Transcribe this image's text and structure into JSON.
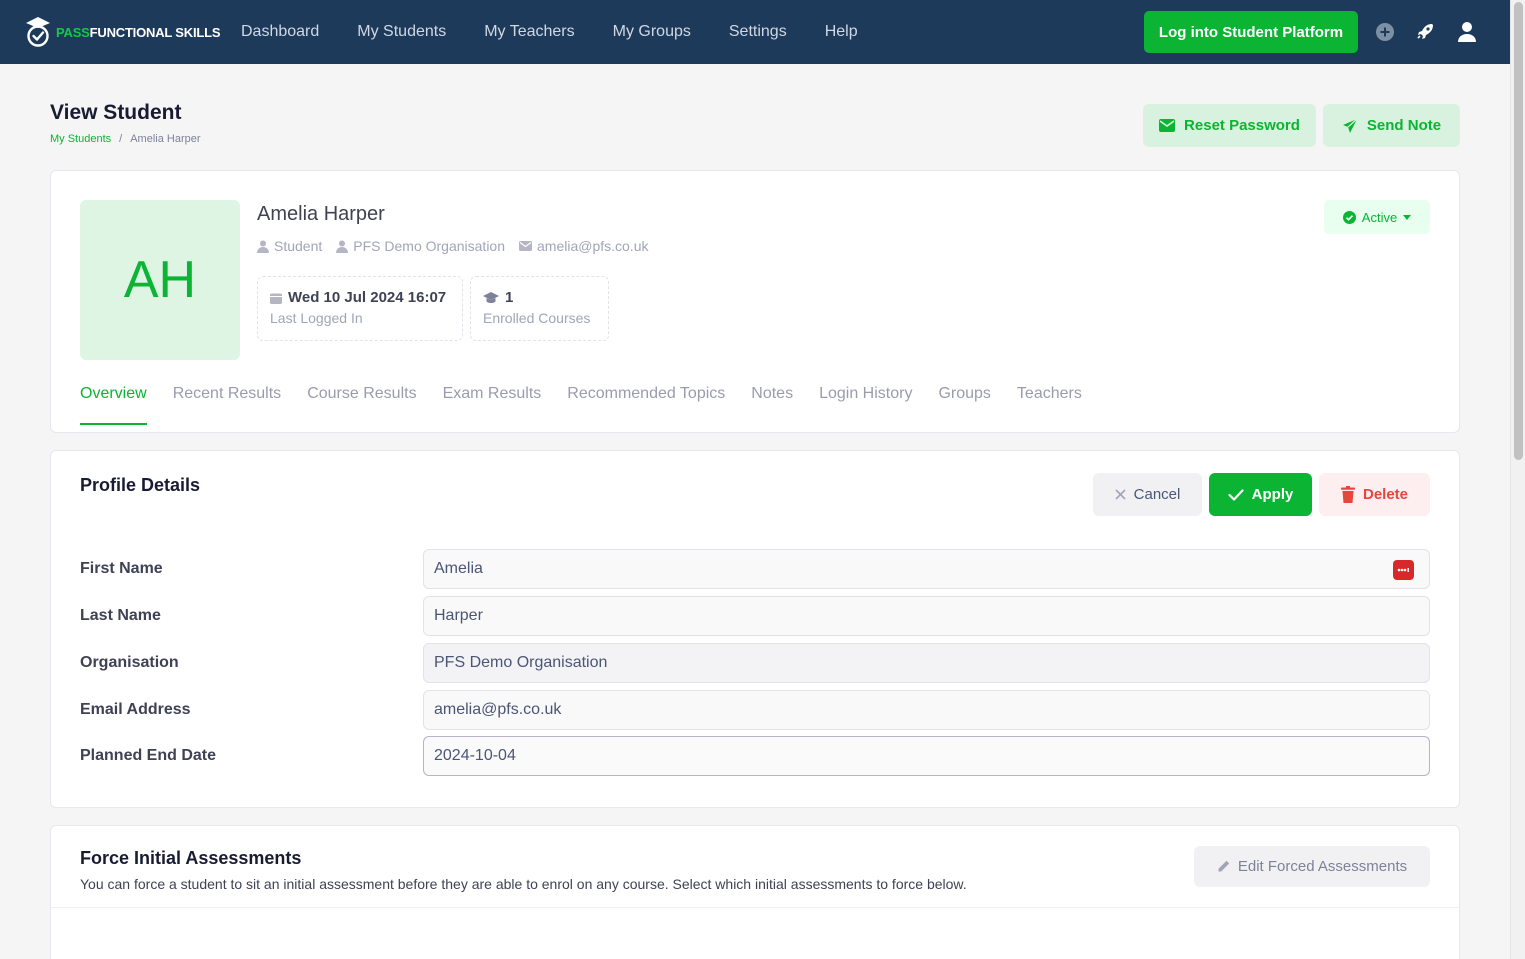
{
  "navbar": {
    "logo_pass": "PASS",
    "logo_rest": "FUNCTIONAL SKILLS",
    "items": [
      "Dashboard",
      "My Students",
      "My Teachers",
      "My Groups",
      "Settings",
      "Help"
    ],
    "login_button": "Log into Student Platform",
    "icons": [
      "plus-circle-icon",
      "rocket-icon",
      "user-icon"
    ]
  },
  "header": {
    "title": "View Student",
    "breadcrumb": [
      "My Students",
      "/",
      "Amelia Harper"
    ],
    "reset_password": "Reset Password",
    "send_note": "Send Note"
  },
  "student": {
    "initials": "AH",
    "name": "Amelia Harper",
    "role": "Student",
    "organisation": "PFS Demo Organisation",
    "email": "amelia@pfs.co.uk",
    "last_logged_in_value": "Wed 10 Jul 2024 16:07",
    "last_logged_in_label": "Last Logged In",
    "enrolled_value": "1",
    "enrolled_label": "Enrolled Courses",
    "status": "Active"
  },
  "tabs": [
    "Overview",
    "Recent Results",
    "Course Results",
    "Exam Results",
    "Recommended Topics",
    "Notes",
    "Login History",
    "Groups",
    "Teachers"
  ],
  "active_tab": "Overview",
  "profile": {
    "title": "Profile Details",
    "cancel": "Cancel",
    "apply": "Apply",
    "delete": "Delete",
    "fields": [
      {
        "label": "First Name",
        "value": "Amelia"
      },
      {
        "label": "Last Name",
        "value": "Harper"
      },
      {
        "label": "Organisation",
        "value": "PFS Demo Organisation"
      },
      {
        "label": "Email Address",
        "value": "amelia@pfs.co.uk"
      },
      {
        "label": "Planned End Date",
        "value": "2024-10-04"
      }
    ]
  },
  "forced": {
    "title": "Force Initial Assessments",
    "description": "You can force a student to sit an initial assessment before they are able to enrol on any course. Select which initial assessments to force below.",
    "edit_button": "Edit Forced Assessments"
  },
  "colors": {
    "navbar": "#1e3a5a",
    "accent": "#0bb432",
    "danger": "#e8453c"
  }
}
